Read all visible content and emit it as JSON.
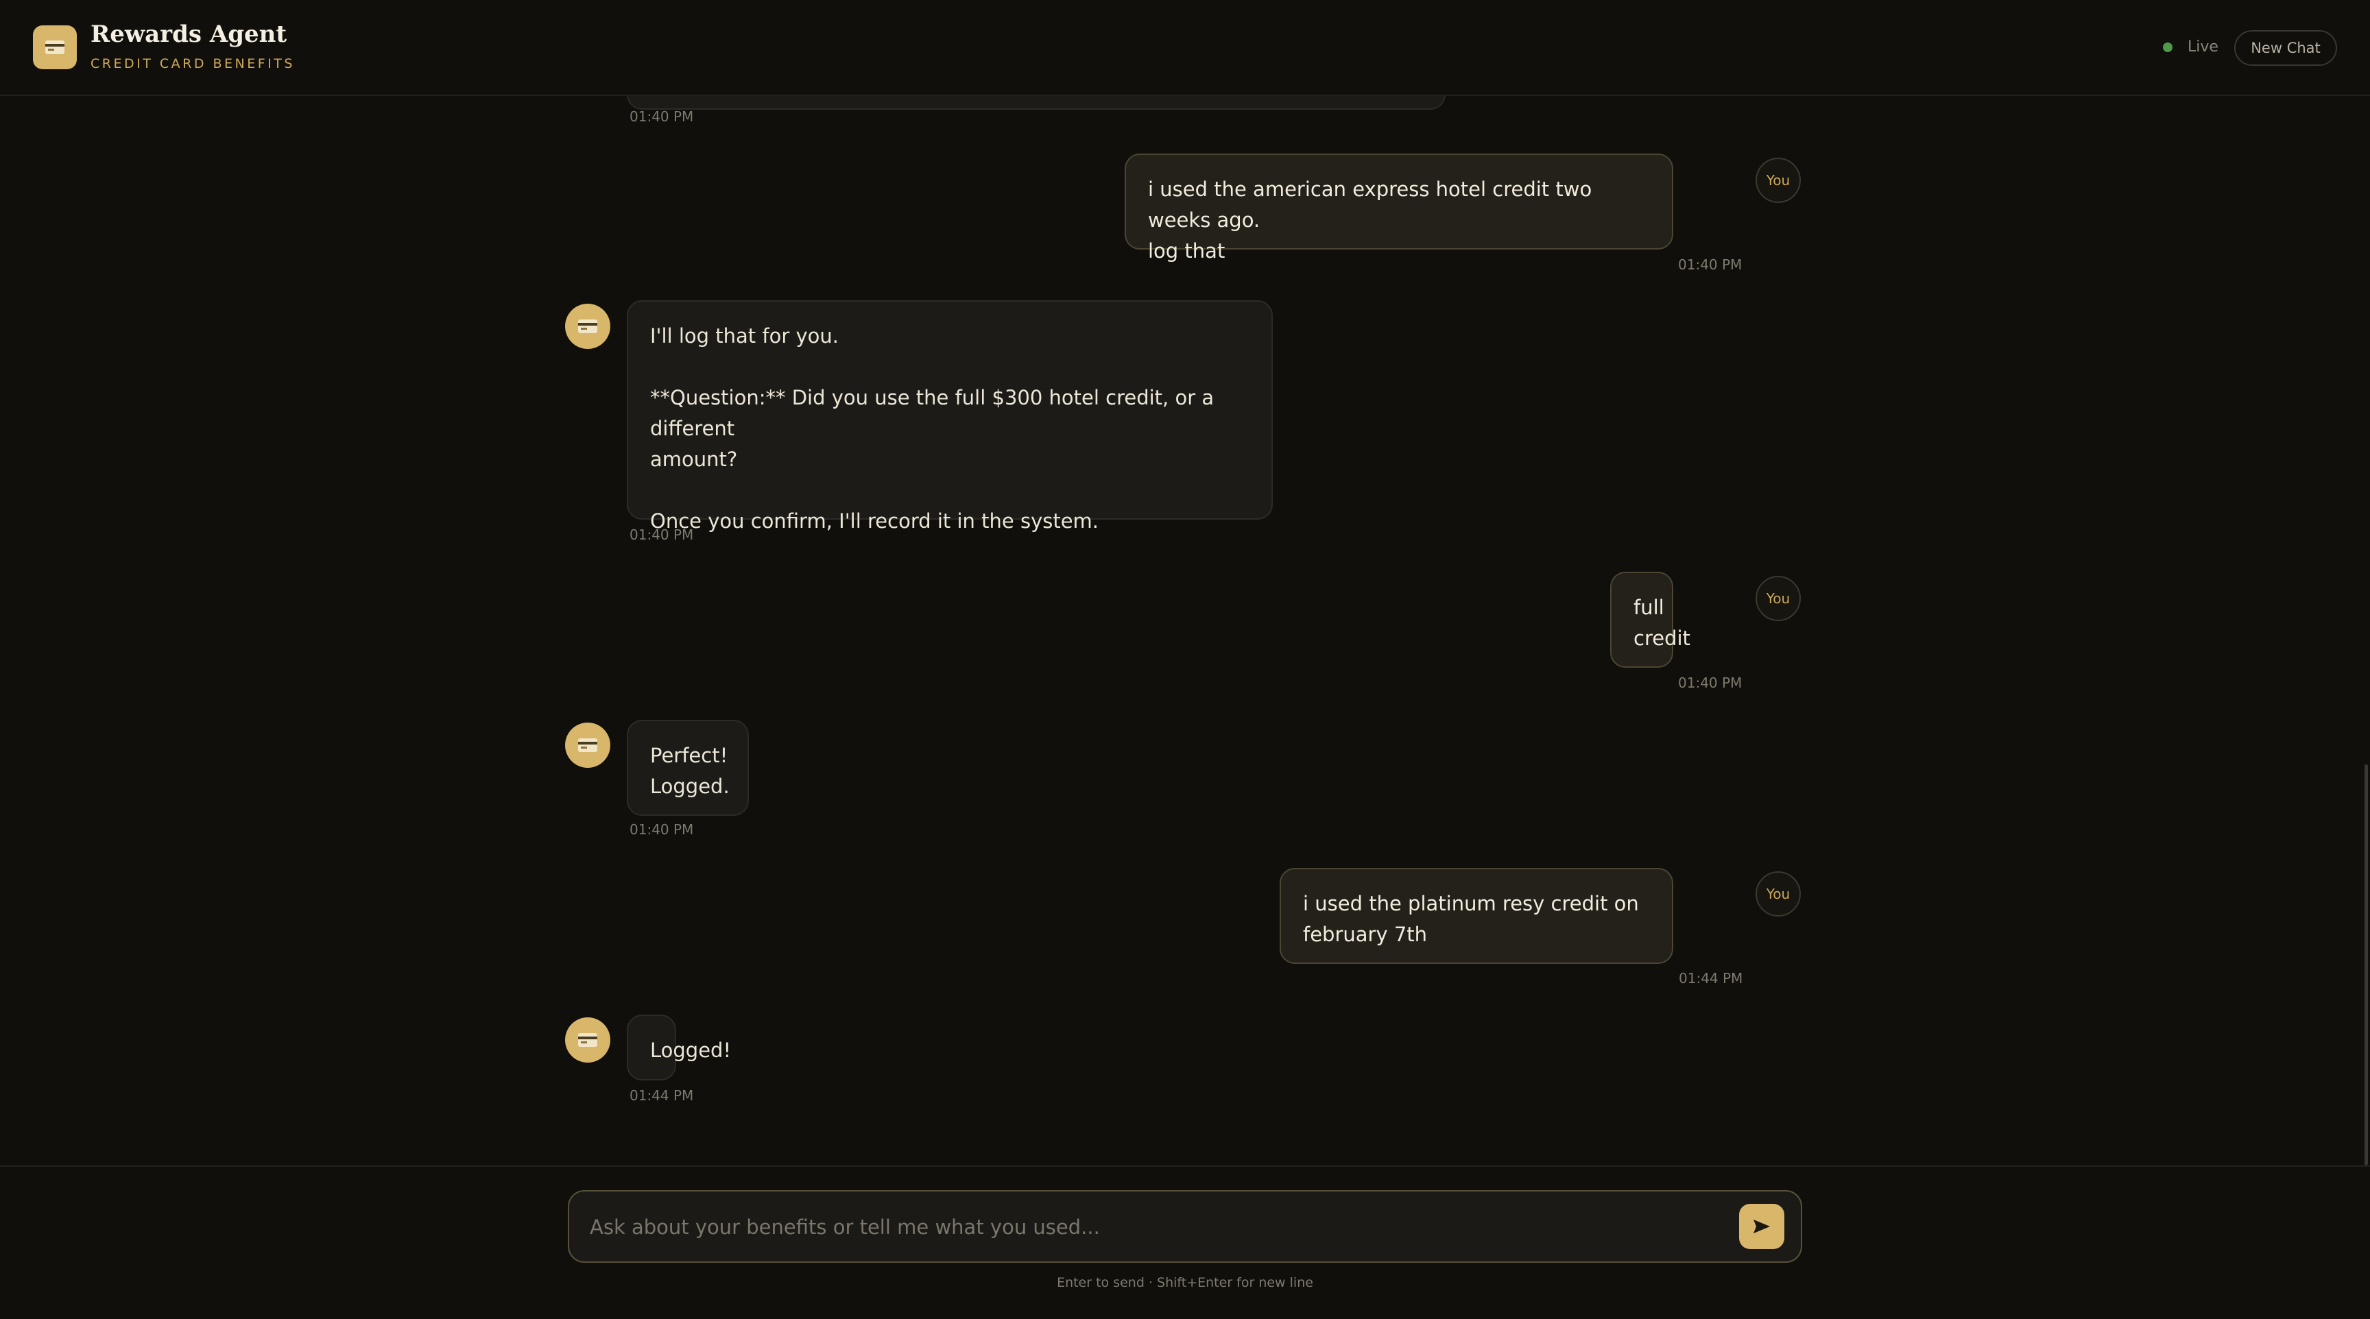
{
  "header": {
    "title": "Rewards Agent",
    "subtitle": "CREDIT CARD BENEFITS",
    "status_label": "Live",
    "new_chat_label": "New Chat",
    "accent_color": "#d8b66a",
    "status_color": "#4f9a4a",
    "logo_icon": "credit-card-icon"
  },
  "chat": {
    "user_avatar_label": "You",
    "agent_avatar_icon": "credit-card-icon",
    "messages": [
      {
        "role": "agent",
        "text": "",
        "time": "01:40 PM"
      },
      {
        "role": "user",
        "text": "i used the american express hotel credit two weeks ago.\nlog that",
        "time": "01:40 PM"
      },
      {
        "role": "agent",
        "text": "I'll log that for you.\n\n**Question:** Did you use the full $300 hotel credit, or a different\namount?\n\nOnce you confirm, I'll record it in the system.",
        "time": "01:40 PM"
      },
      {
        "role": "user",
        "text": "full\ncredit",
        "time": "01:40 PM"
      },
      {
        "role": "agent",
        "text": "Perfect!\nLogged.",
        "time": "01:40 PM"
      },
      {
        "role": "user",
        "text": "i used the platinum resy credit on\nfebruary 7th",
        "time": "01:44 PM"
      },
      {
        "role": "agent",
        "text": "Logged!",
        "time": "01:44 PM"
      }
    ]
  },
  "composer": {
    "placeholder": "Ask about your benefits or tell me what you used...",
    "value": "",
    "send_icon": "send-icon",
    "hint": "Enter to send · Shift+Enter for new line"
  }
}
